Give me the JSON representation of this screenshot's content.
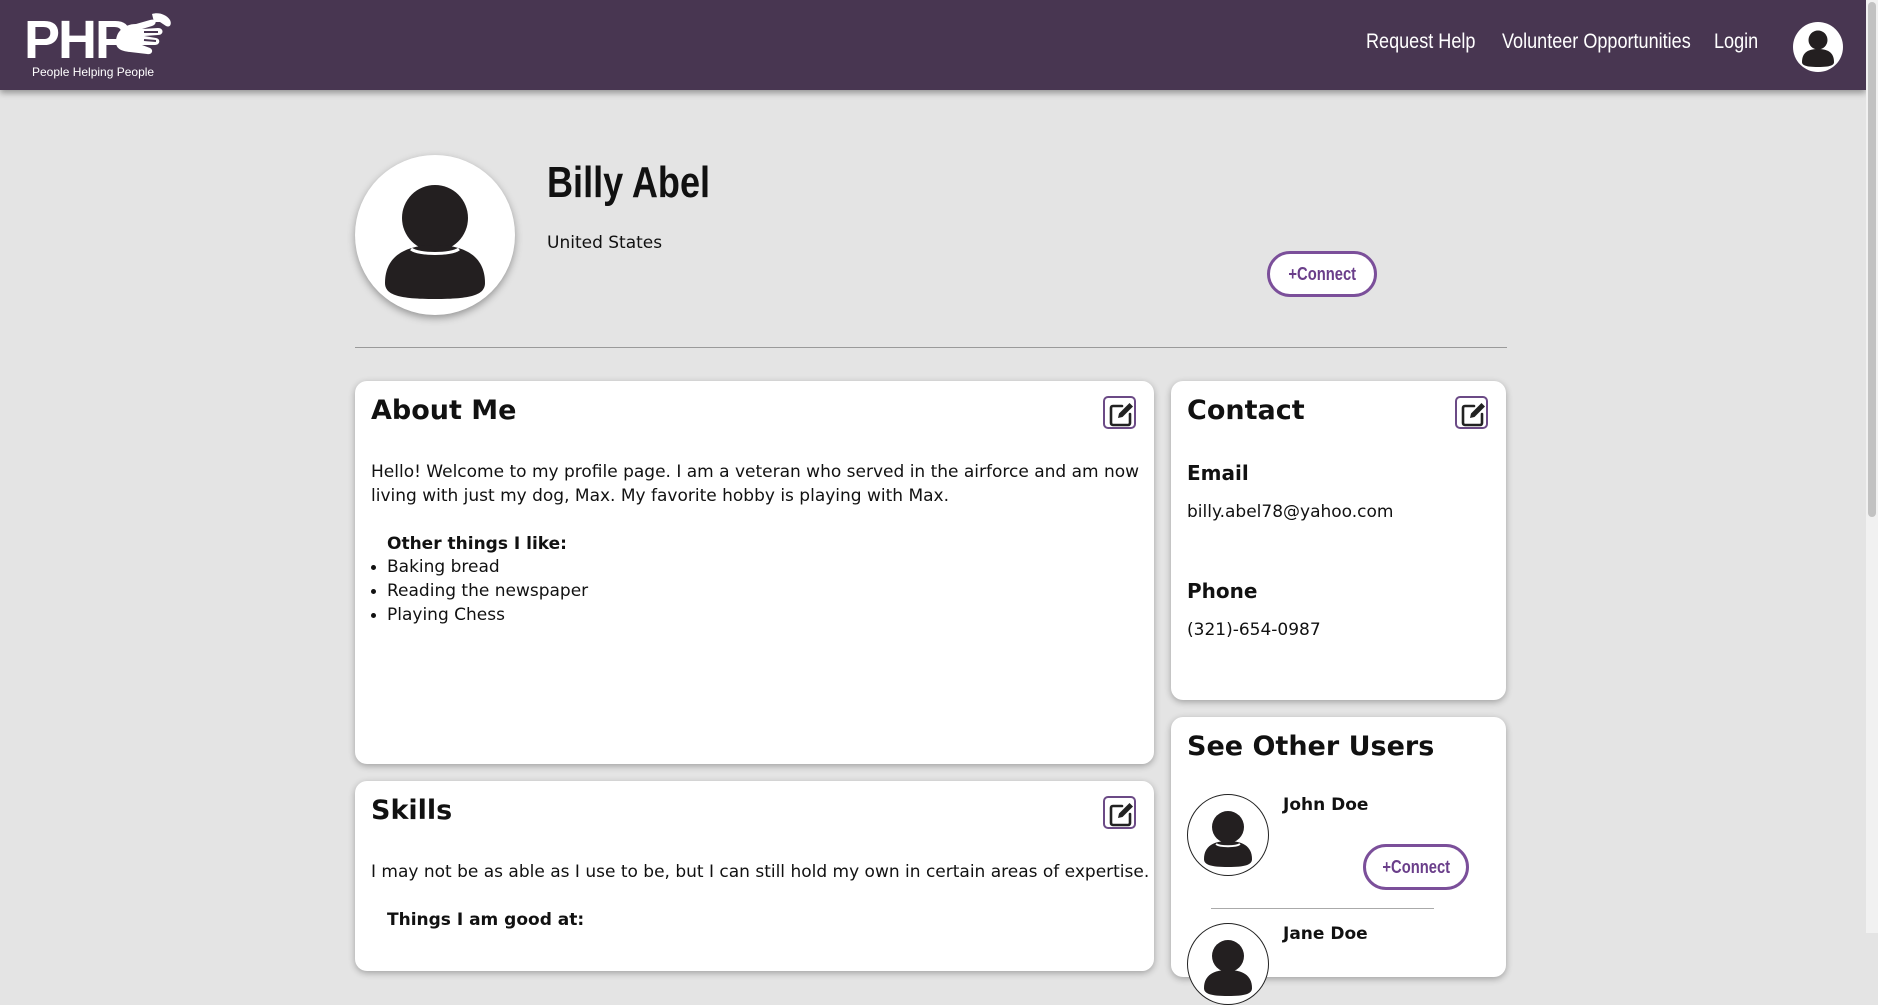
{
  "brand": {
    "name": "PHP",
    "tagline": "People Helping People"
  },
  "nav": {
    "request_help": "Request Help",
    "volunteer": "Volunteer Opportunities",
    "login": "Login"
  },
  "colors": {
    "navbar": "#483651",
    "accent": "#7b4f9a",
    "page_bg": "#e4e4e4"
  },
  "profile": {
    "name": "Billy Abel",
    "location": "United States",
    "connect_label": "+Connect"
  },
  "about": {
    "title": "About Me",
    "text_line1": "Hello! Welcome to my profile page. I am a veteran who served in the airforce and am now",
    "text_line2": "living with just my dog, Max. My favorite hobby is playing with Max.",
    "likes_label": "Other things I like:",
    "likes": [
      "Baking bread",
      "Reading the newspaper",
      "Playing Chess"
    ]
  },
  "skills": {
    "title": "Skills",
    "text": "I may not be as able as I use to be, but I can still hold my own in certain areas of expertise.",
    "good_at_label": "Things I am good at:"
  },
  "contact": {
    "title": "Contact",
    "email_label": "Email",
    "email": "billy.abel78@yahoo.com",
    "phone_label": "Phone",
    "phone": "(321)-654-0987"
  },
  "other_users": {
    "title": "See Other Users",
    "users": [
      {
        "name": "John Doe",
        "connect_label": "+Connect"
      },
      {
        "name": "Jane Doe"
      }
    ]
  },
  "icons": [
    "user-avatar-icon",
    "edit-icon",
    "hand-logo-icon"
  ]
}
